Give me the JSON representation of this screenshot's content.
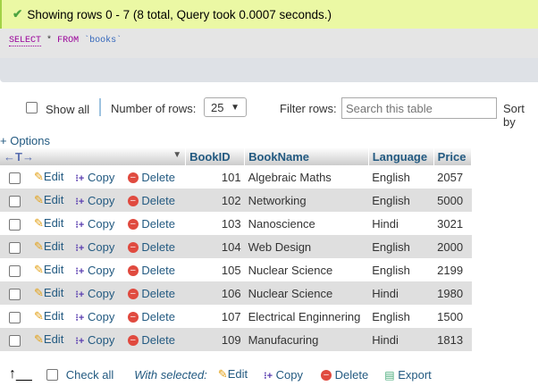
{
  "message": "Showing rows 0 - 7 (8 total, Query took 0.0007 seconds.)",
  "sql": {
    "select": "SELECT",
    "star": "*",
    "from": "FROM",
    "table": "`books`"
  },
  "controls": {
    "show_all": "Show all",
    "num_rows_label": "Number of rows:",
    "num_rows_value": "25",
    "filter_label": "Filter rows:",
    "filter_placeholder": "Search this table",
    "sort_label": "Sort by"
  },
  "options": "+ Options",
  "columns": [
    "BookID",
    "BookName",
    "Language",
    "Price"
  ],
  "actions": {
    "edit": "Edit",
    "copy": "Copy",
    "delete": "Delete"
  },
  "rows": [
    [
      "101",
      "Algebraic Maths",
      "English",
      "2057"
    ],
    [
      "102",
      "Networking",
      "English",
      "5000"
    ],
    [
      "103",
      "Nanoscience",
      "Hindi",
      "3021"
    ],
    [
      "104",
      "Web Design",
      "English",
      "2000"
    ],
    [
      "105",
      "Nuclear Science",
      "English",
      "2199"
    ],
    [
      "106",
      "Nuclear Science",
      "Hindi",
      "1980"
    ],
    [
      "107",
      "Electrical Enginnering",
      "English",
      "1500"
    ],
    [
      "109",
      "Manufacuring",
      "Hindi",
      "1813"
    ]
  ],
  "footer": {
    "check_all": "Check all",
    "with_selected": "With selected:",
    "edit": "Edit",
    "copy": "Copy",
    "delete": "Delete",
    "export": "Export"
  }
}
